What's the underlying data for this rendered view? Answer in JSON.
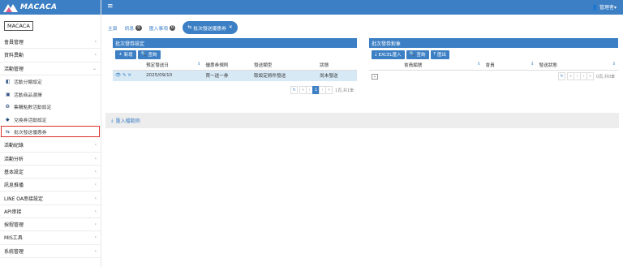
{
  "app": {
    "logo_text": "MACACA",
    "brand_label": "MACACA",
    "brand_color": "#3c7fc4"
  },
  "topbar": {
    "menu_icon": "hamburger-icon",
    "user_label": "管理者▾"
  },
  "sidebar": {
    "items": [
      {
        "label": "會員管理",
        "chev": "‹"
      },
      {
        "label": "資料異動",
        "chev": "‹"
      },
      {
        "label": "活動管理",
        "chev": "⌄"
      }
    ],
    "sub_items": [
      {
        "label": "活動分類設定",
        "icon": "◧"
      },
      {
        "label": "活動商品選擇",
        "icon": "▣"
      },
      {
        "label": "集購點數活動設定",
        "icon": "❂"
      },
      {
        "label": "兌換券活動設定",
        "icon": "◆"
      },
      {
        "label": "批次發送優惠券",
        "icon": "⇆"
      }
    ],
    "items_after": [
      {
        "label": "活動紀錄",
        "chev": "‹"
      },
      {
        "label": "活動分析",
        "chev": "‹"
      },
      {
        "label": "基本設定",
        "chev": "‹"
      },
      {
        "label": "訊息推播",
        "chev": "‹"
      },
      {
        "label": "LINE OA串接設定",
        "chev": "‹"
      },
      {
        "label": "API串接",
        "chev": "‹"
      },
      {
        "label": "採程管理",
        "chev": "‹"
      },
      {
        "label": "MIS工具",
        "chev": "‹"
      },
      {
        "label": "系統管理",
        "chev": "‹"
      }
    ]
  },
  "tabs": [
    {
      "label": "主頁",
      "badge": ""
    },
    {
      "label": "訊息",
      "badge": "0"
    },
    {
      "label": "匯入事項",
      "badge": "0"
    },
    {
      "label": "批次發送優惠券",
      "badge": ""
    }
  ],
  "left_panel": {
    "title": "批次發券設定",
    "buttons": {
      "add": "新增",
      "query": "查詢"
    },
    "columns": [
      "預定發送日",
      "優惠券規則",
      "發送類型",
      "狀態"
    ],
    "rows": [
      {
        "date": "2025/09/10",
        "rule": "買一送一券",
        "type": "取設定將件發送",
        "status": "尚未發送"
      }
    ],
    "pager": {
      "page": "1",
      "info": "1頁,共1筆"
    }
  },
  "right_panel": {
    "title": "批次發券對象",
    "buttons": {
      "excel": "EXCEL匯入",
      "query": "查詢",
      "export": "匯出"
    },
    "columns": [
      "會員編號",
      "會員",
      "發送狀態"
    ],
    "pager": {
      "info": "0頁,共0筆"
    }
  },
  "import_bar": {
    "label": "匯入檔範例"
  }
}
